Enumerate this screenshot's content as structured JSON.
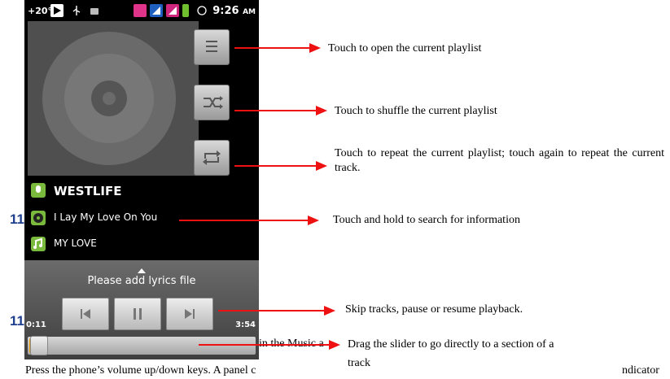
{
  "status_bar": {
    "temperature": "+20°",
    "time": "9:26",
    "ampm": "AM"
  },
  "track": {
    "artist": "WESTLIFE",
    "title": "I Lay My Love On You",
    "album": "MY LOVE"
  },
  "lyrics_prompt": "Please add lyrics file",
  "playback": {
    "elapsed": "0:11",
    "duration": "3:54",
    "progress_fraction": 0.05
  },
  "annotations": {
    "playlist": "Touch to open the current playlist",
    "shuffle": "Touch to shuffle the current playlist",
    "repeat": "Touch to repeat the current playlist; touch again to repeat the current track.",
    "search": "Touch and hold to search for information",
    "skip": "Skip tracks, pause or resume playback.",
    "slider_line1": "Drag the slider to go directly to a section of a",
    "slider_line2": "track"
  },
  "doc_text": {
    "margin_num": "11",
    "margin_num2": "11",
    "partial_inline": "in the Music a",
    "press_line": "Press the phone’s volume up/down keys. A panel c",
    "indicator": "ndicator"
  },
  "colors": {
    "arrow": "#ee1111",
    "accent_green": "#79b93b",
    "seek_fill": "#f0a000"
  },
  "icons": {
    "playlist": "list-icon",
    "shuffle": "shuffle-icon",
    "repeat": "repeat-icon",
    "prev": "skip-previous-icon",
    "pause": "pause-icon",
    "next": "skip-next-icon"
  }
}
